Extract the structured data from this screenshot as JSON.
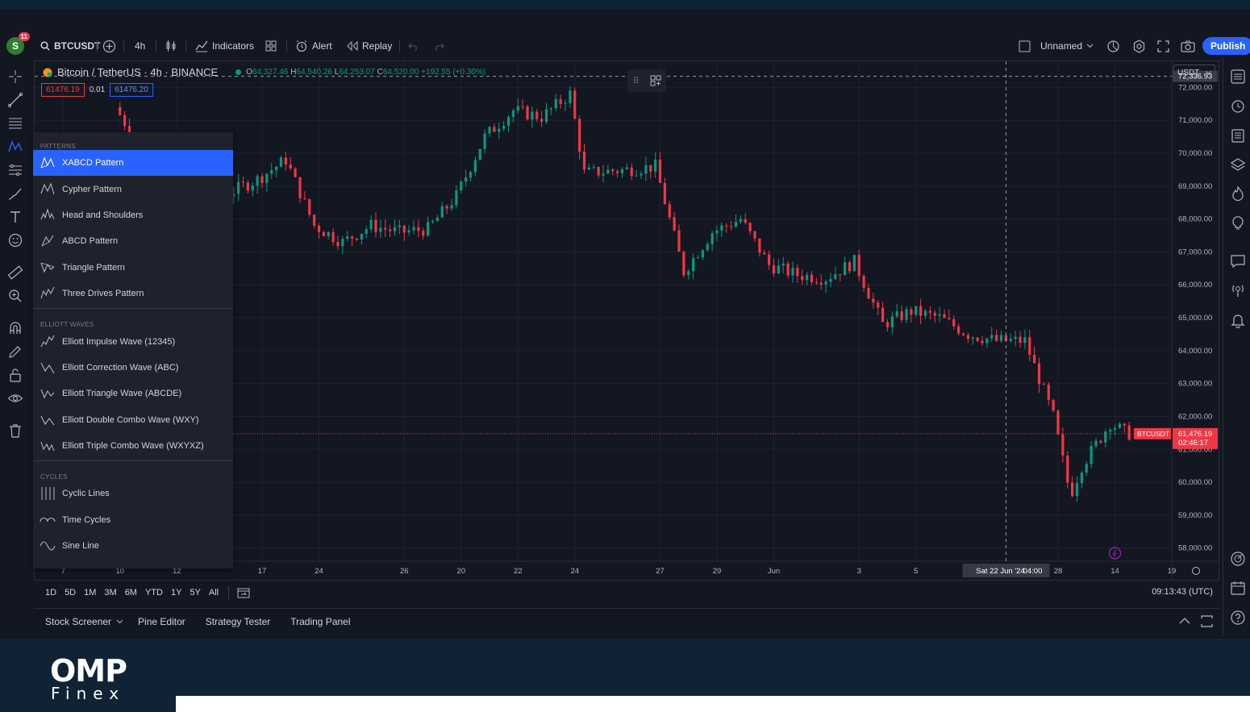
{
  "toolbar": {
    "avatar_letter": "S",
    "notification_count": "11",
    "symbol": "BTCUSDT",
    "interval": "4h",
    "indicators_label": "Indicators",
    "alert_label": "Alert",
    "replay_label": "Replay",
    "layout_name": "Unnamed",
    "publish_label": "Publish"
  },
  "legend": {
    "title": "Bitcoin / TetherUS · 4h · BINANCE",
    "open": "64,327.46",
    "high": "64,540.26",
    "low": "64,253.07",
    "close": "64,520.00",
    "change": "+192.55 (+0.30%)",
    "sell_price": "61476.19",
    "spread": "0.01",
    "buy_price": "61476.20"
  },
  "currency": "USDT",
  "price_axis": {
    "ticks": [
      "72,000.00",
      "71,000.00",
      "70,000.00",
      "69,000.00",
      "68,000.00",
      "67,000.00",
      "66,000.00",
      "65,000.00",
      "64,000.00",
      "63,000.00",
      "62,000.00",
      "61,000.00",
      "60,000.00",
      "59,000.00",
      "58,000.00"
    ],
    "crosshair_price": "72,336.93",
    "last_symbol": "BTCUSDT",
    "last_price": "61,476.19",
    "countdown": "02:46:17"
  },
  "time_axis": {
    "ticks": [
      "20",
      "22",
      "24",
      "27",
      "29",
      "Jun",
      "3",
      "5",
      "7",
      "10",
      "12",
      "14",
      "17",
      "19",
      "24",
      "26",
      "28"
    ],
    "crosshair_label": "Sat 22 Jun '24",
    "crosshair_time": "04:00"
  },
  "menu": {
    "sections": [
      {
        "title": "PATTERNS",
        "items": [
          {
            "label": "XABCD Pattern",
            "icon": "xabcd-icon",
            "active": true
          },
          {
            "label": "Cypher Pattern",
            "icon": "cypher-icon"
          },
          {
            "label": "Head and Shoulders",
            "icon": "head-shoulders-icon"
          },
          {
            "label": "ABCD Pattern",
            "icon": "abcd-icon"
          },
          {
            "label": "Triangle Pattern",
            "icon": "triangle-icon"
          },
          {
            "label": "Three Drives Pattern",
            "icon": "three-drives-icon"
          }
        ]
      },
      {
        "title": "ELLIOTT WAVES",
        "items": [
          {
            "label": "Elliott Impulse Wave (12345)",
            "icon": "elliott-impulse-icon"
          },
          {
            "label": "Elliott Correction Wave (ABC)",
            "icon": "elliott-correction-icon"
          },
          {
            "label": "Elliott Triangle Wave (ABCDE)",
            "icon": "elliott-triangle-icon"
          },
          {
            "label": "Elliott Double Combo Wave (WXY)",
            "icon": "elliott-double-icon"
          },
          {
            "label": "Elliott Triple Combo Wave (WXYXZ)",
            "icon": "elliott-triple-icon"
          }
        ]
      },
      {
        "title": "CYCLES",
        "items": [
          {
            "label": "Cyclic Lines",
            "icon": "cyclic-lines-icon"
          },
          {
            "label": "Time Cycles",
            "icon": "time-cycles-icon"
          },
          {
            "label": "Sine Line",
            "icon": "sine-line-icon"
          }
        ]
      }
    ]
  },
  "ranges": [
    "1D",
    "5D",
    "1M",
    "3M",
    "6M",
    "YTD",
    "1Y",
    "5Y",
    "All"
  ],
  "clock": "09:13:43 (UTC)",
  "bottom_tabs": [
    "Stock Screener",
    "Pine Editor",
    "Strategy Tester",
    "Trading Panel"
  ],
  "brand": {
    "line1": "OMP",
    "line2": "Finex"
  },
  "colors": {
    "up": "#089981",
    "down": "#f23645",
    "accent": "#2962ff"
  },
  "chart_data": {
    "type": "candlestick",
    "symbol": "BTCUSDT",
    "interval": "4h",
    "ylim": [
      57600,
      72500
    ],
    "x_range": [
      "May 19",
      "Jun 28"
    ],
    "anchors": [
      [
        "May 22",
        71400
      ],
      [
        "May 24",
        68600
      ],
      [
        "May 25",
        69300
      ],
      [
        "May 26",
        68800
      ],
      [
        "May 27",
        69200
      ],
      [
        "May 28",
        69800
      ],
      [
        "May 29",
        67800
      ],
      [
        "May 30",
        67300
      ],
      [
        "May 31",
        67800
      ],
      [
        "Jun 1",
        67600
      ],
      [
        "Jun 2",
        67700
      ],
      [
        "Jun 3",
        68700
      ],
      [
        "Jun 4",
        70500
      ],
      [
        "Jun 5",
        71300
      ],
      [
        "Jun 6",
        71100
      ],
      [
        "Jun 7",
        71800
      ],
      [
        "Jun 7.5",
        69400
      ],
      [
        "Jun 9",
        69500
      ],
      [
        "Jun 10",
        69600
      ],
      [
        "Jun 11",
        66400
      ],
      [
        "Jun 12",
        67600
      ],
      [
        "Jun 13",
        68000
      ],
      [
        "Jun 14",
        66600
      ],
      [
        "Jun 15",
        66300
      ],
      [
        "Jun 16",
        66200
      ],
      [
        "Jun 17",
        66700
      ],
      [
        "Jun 18",
        64800
      ],
      [
        "Jun 19",
        65200
      ],
      [
        "Jun 20",
        65000
      ],
      [
        "Jun 21",
        64500
      ],
      [
        "Jun 22",
        64300
      ],
      [
        "Jun 23",
        64300
      ],
      [
        "Jun 24",
        62000
      ],
      [
        "Jun 24.6",
        59600
      ],
      [
        "Jun 25",
        60500
      ],
      [
        "Jun 26",
        61800
      ],
      [
        "Jun 26.6",
        61476
      ]
    ]
  }
}
